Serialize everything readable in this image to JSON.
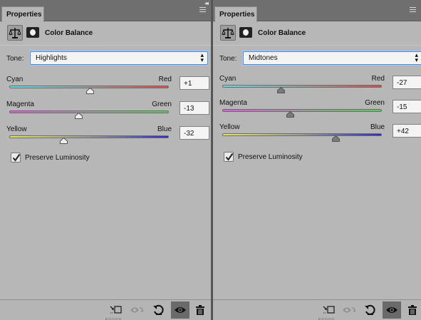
{
  "collapse_glyph": "◂◂",
  "panels": [
    {
      "tab_label": "Properties",
      "title": "Color Balance",
      "tone_label": "Tone:",
      "tone_value": "Highlights",
      "sliders": [
        {
          "left": "Cyan",
          "right": "Red",
          "value": "+1",
          "level": 1,
          "colors": [
            "#5fe0e6",
            "#e04a4a"
          ]
        },
        {
          "left": "Magenta",
          "right": "Green",
          "value": "-13",
          "level": -13,
          "colors": [
            "#e456e0",
            "#52d252"
          ]
        },
        {
          "left": "Yellow",
          "right": "Blue",
          "value": "-32",
          "level": -32,
          "colors": [
            "#e8e85a",
            "#2b2bd0"
          ]
        }
      ],
      "preserve_luminosity_label": "Preserve Luminosity",
      "preserve_luminosity_checked": true
    },
    {
      "tab_label": "Properties",
      "title": "Color Balance",
      "tone_label": "Tone:",
      "tone_value": "Midtones",
      "sliders": [
        {
          "left": "Cyan",
          "right": "Red",
          "value": "-27",
          "level": -27,
          "colors": [
            "#5fe0e6",
            "#e04a4a"
          ]
        },
        {
          "left": "Magenta",
          "right": "Green",
          "value": "-15",
          "level": -15,
          "colors": [
            "#e456e0",
            "#52d252"
          ]
        },
        {
          "left": "Yellow",
          "right": "Blue",
          "value": "+42",
          "level": 42,
          "colors": [
            "#e8e85a",
            "#2b2bd0"
          ]
        }
      ],
      "preserve_luminosity_label": "Preserve Luminosity",
      "preserve_luminosity_checked": true
    }
  ],
  "footer_icons": [
    "clip-to-layer-icon",
    "view-previous-state-icon",
    "reset-icon",
    "visibility-eye-icon",
    "trash-icon"
  ]
}
